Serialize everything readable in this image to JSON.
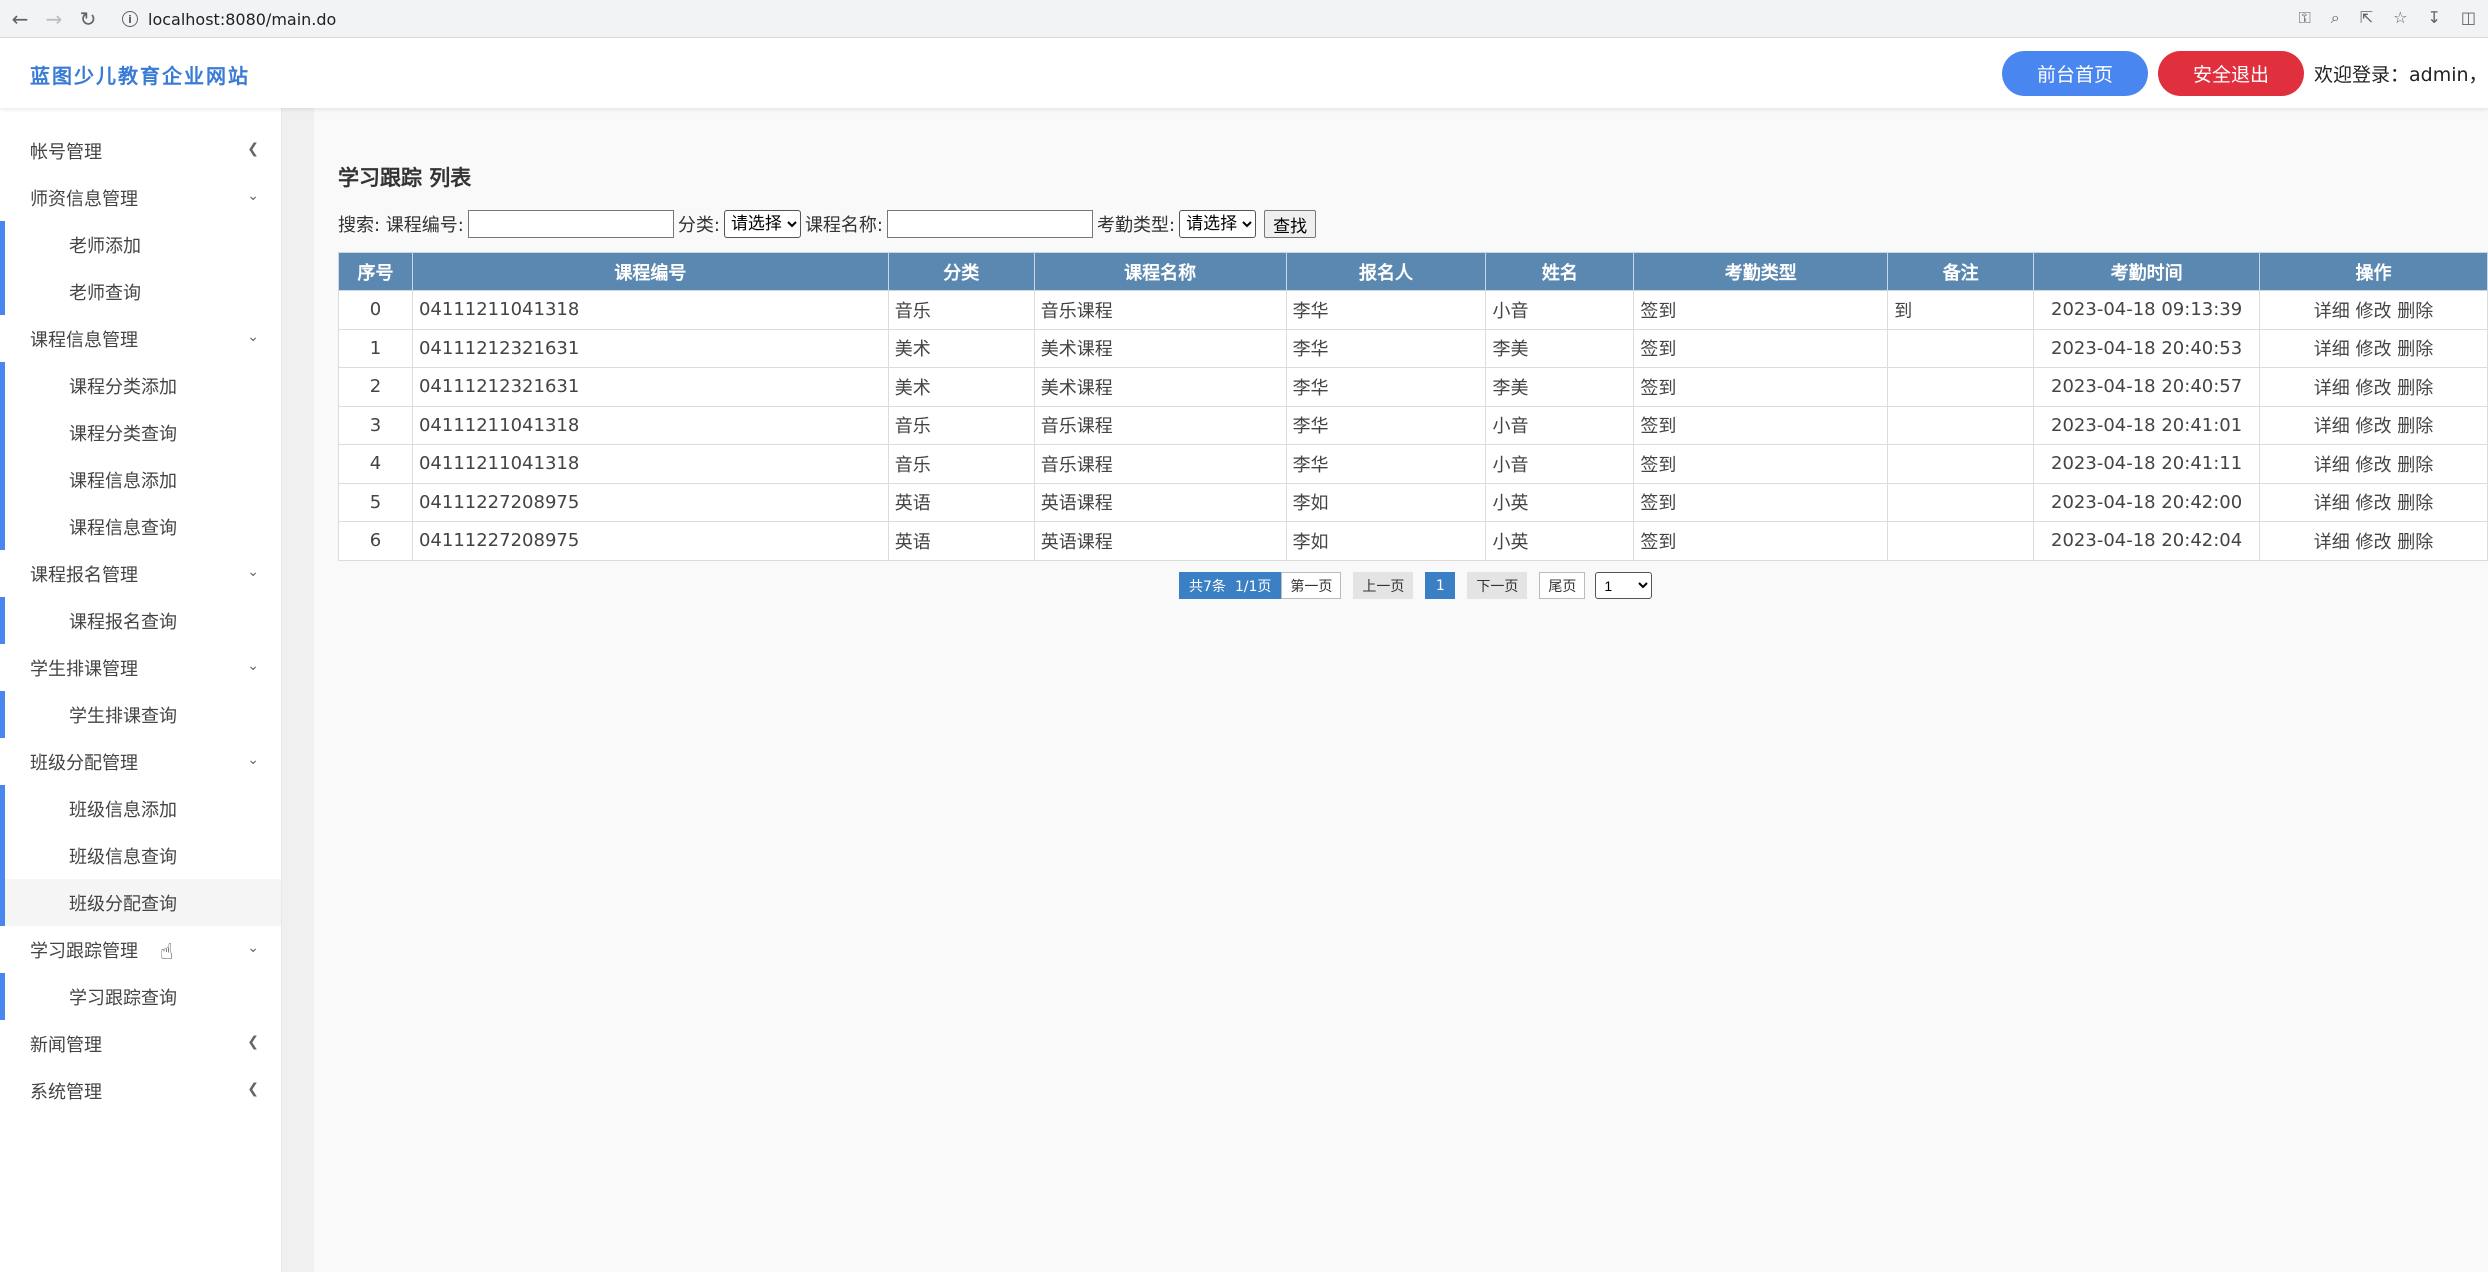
{
  "browser": {
    "url": "localhost:8080/main.do"
  },
  "header": {
    "site_title": "蓝图少儿教育企业网站",
    "home_button": "前台首页",
    "logout_button": "安全退出",
    "welcome_text": "欢迎登录：admin，管"
  },
  "sidebar": {
    "account": "帐号管理",
    "teacher_group": "师资信息管理",
    "teacher_add": "老师添加",
    "teacher_query": "老师查询",
    "course_group": "课程信息管理",
    "course_cat_add": "课程分类添加",
    "course_cat_query": "课程分类查询",
    "course_info_add": "课程信息添加",
    "course_info_query": "课程信息查询",
    "signup_group": "课程报名管理",
    "signup_query": "课程报名查询",
    "schedule_group": "学生排课管理",
    "schedule_query": "学生排课查询",
    "class_group": "班级分配管理",
    "class_info_add": "班级信息添加",
    "class_info_query": "班级信息查询",
    "class_assign_query": "班级分配查询",
    "track_group": "学习跟踪管理",
    "track_query": "学习跟踪查询",
    "news_group": "新闻管理",
    "system_group": "系统管理"
  },
  "main": {
    "heading": "学习跟踪 列表",
    "search": {
      "label_prefix": "搜索: 课程编号:",
      "label_category": "分类:",
      "category_selected": "请选择",
      "label_course_name": "课程名称:",
      "label_attendance": "考勤类型:",
      "attendance_selected": "请选择",
      "button": "查找"
    },
    "table": {
      "headers": {
        "no": "序号",
        "code": "课程编号",
        "category": "分类",
        "course_name": "课程名称",
        "applicant": "报名人",
        "name": "姓名",
        "attendance": "考勤类型",
        "remark": "备注",
        "time": "考勤时间",
        "ops": "操作"
      },
      "rows": [
        {
          "no": "0",
          "code": "04111211041318",
          "category": "音乐",
          "course_name": "音乐课程",
          "applicant": "李华",
          "name": "小音",
          "attendance": "签到",
          "remark": "到",
          "time": "2023-04-18 09:13:39",
          "ops": "详细 修改 删除"
        },
        {
          "no": "1",
          "code": "04111212321631",
          "category": "美术",
          "course_name": "美术课程",
          "applicant": "李华",
          "name": "李美",
          "attendance": "签到",
          "remark": "",
          "time": "2023-04-18 20:40:53",
          "ops": "详细 修改 删除"
        },
        {
          "no": "2",
          "code": "04111212321631",
          "category": "美术",
          "course_name": "美术课程",
          "applicant": "李华",
          "name": "李美",
          "attendance": "签到",
          "remark": "",
          "time": "2023-04-18 20:40:57",
          "ops": "详细 修改 删除"
        },
        {
          "no": "3",
          "code": "04111211041318",
          "category": "音乐",
          "course_name": "音乐课程",
          "applicant": "李华",
          "name": "小音",
          "attendance": "签到",
          "remark": "",
          "time": "2023-04-18 20:41:01",
          "ops": "详细 修改 删除"
        },
        {
          "no": "4",
          "code": "04111211041318",
          "category": "音乐",
          "course_name": "音乐课程",
          "applicant": "李华",
          "name": "小音",
          "attendance": "签到",
          "remark": "",
          "time": "2023-04-18 20:41:11",
          "ops": "详细 修改 删除"
        },
        {
          "no": "5",
          "code": "04111227208975",
          "category": "英语",
          "course_name": "英语课程",
          "applicant": "李如",
          "name": "小英",
          "attendance": "签到",
          "remark": "",
          "time": "2023-04-18 20:42:00",
          "ops": "详细 修改 删除"
        },
        {
          "no": "6",
          "code": "04111227208975",
          "category": "英语",
          "course_name": "英语课程",
          "applicant": "李如",
          "name": "小英",
          "attendance": "签到",
          "remark": "",
          "time": "2023-04-18 20:42:04",
          "ops": "详细 修改 删除"
        }
      ]
    },
    "pager": {
      "total": "共7条",
      "page_info": "1/1页",
      "first": "第一页",
      "prev": "上一页",
      "current": "1",
      "next": "下一页",
      "last": "尾页",
      "select_value": "1"
    }
  },
  "colors": {
    "accent": "#4a86f0",
    "danger": "#e0303e",
    "table_header": "#5b88b0"
  }
}
